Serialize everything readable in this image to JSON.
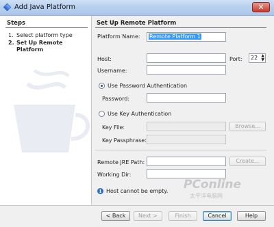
{
  "window": {
    "title": "Add Java Platform",
    "close_glyph": "✕"
  },
  "steps": {
    "title": "Steps",
    "items": [
      {
        "num": "1.",
        "label": "Select platform type"
      },
      {
        "num": "2.",
        "label": "Set Up Remote",
        "label2": "Platform"
      }
    ]
  },
  "panel": {
    "title": "Set Up Remote Platform",
    "platform_name_label": "Platform Name:",
    "platform_name_value": "Remote Platform 1",
    "host_label": "Host:",
    "host_value": "",
    "port_label": "Port:",
    "port_value": "22",
    "username_label": "Username:",
    "username_value": "",
    "use_password_label": "Use Password Authentication",
    "password_label": "Password:",
    "password_value": "",
    "use_key_label": "Use Key Authentication",
    "key_file_label": "Key File:",
    "key_file_value": "",
    "browse_label": "Browse...",
    "key_passphrase_label": "Key Passphrase:",
    "key_passphrase_value": "",
    "remote_jre_label": "Remote JRE Path:",
    "remote_jre_value": "",
    "create_label": "Create...",
    "working_dir_label": "Working Dir:",
    "working_dir_value": "",
    "status_message": "Host cannot be empty."
  },
  "buttons": {
    "back": "< Back",
    "next": "Next >",
    "finish": "Finish",
    "cancel": "Cancel",
    "help": "Help"
  },
  "watermark": {
    "brand": "PConline",
    "sub": "太平洋电脑网"
  },
  "colors": {
    "accent": "#3399ff",
    "info": "#2f6fc4"
  }
}
